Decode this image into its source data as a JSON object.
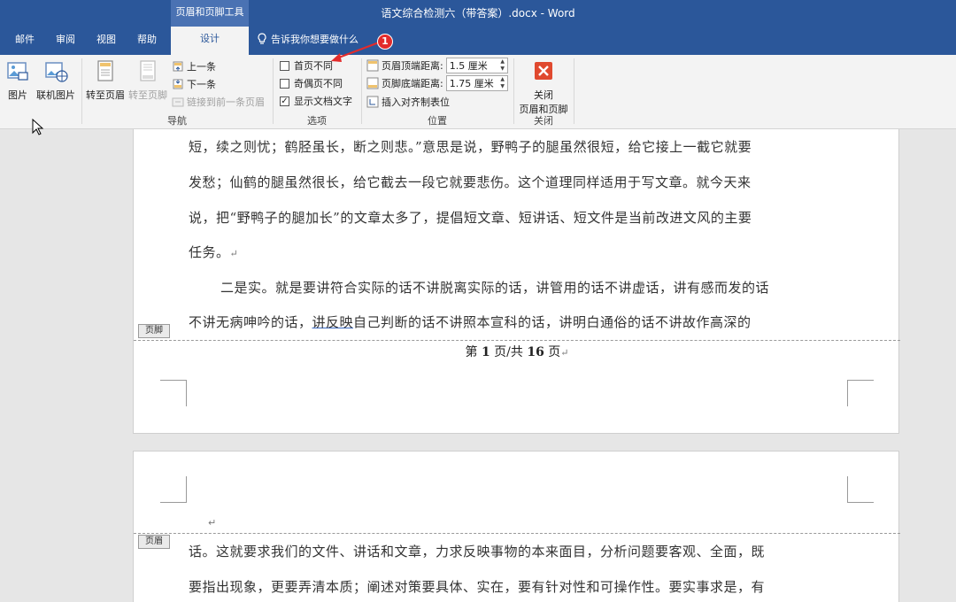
{
  "window": {
    "title": "语文综合检测六（带答案）.docx  -  Word",
    "context_group": "页眉和页脚工具",
    "tabs": [
      "邮件",
      "审阅",
      "视图",
      "帮助"
    ],
    "active_tab": "设计",
    "tell_me": "告诉我你想要做什么"
  },
  "ribbon": {
    "insert": {
      "picture": "图片",
      "online_picture": "联机图片"
    },
    "navigation": {
      "goto_header": "转至页眉",
      "goto_footer": "转至页脚",
      "previous": "上一条",
      "next": "下一条",
      "link_previous": "链接到前一条页眉",
      "group_label": "导航"
    },
    "options": {
      "diff_first": {
        "label": "首页不同",
        "checked": false
      },
      "diff_odd_even": {
        "label": "奇偶页不同",
        "checked": false
      },
      "show_doc_text": {
        "label": "显示文档文字",
        "checked": true
      },
      "group_label": "选项"
    },
    "position": {
      "header_from_top_label": "页眉顶端距离:",
      "header_from_top_value": "1.5 厘米",
      "footer_from_bottom_label": "页脚底端距离:",
      "footer_from_bottom_value": "1.75 厘米",
      "insert_align_tab": "插入对齐制表位",
      "group_label": "位置"
    },
    "close": {
      "label_line1": "关闭",
      "label_line2": "页眉和页脚",
      "group_label": "关闭"
    }
  },
  "annotation": {
    "marker": "1",
    "color": "#e32b2b"
  },
  "page1": {
    "lines": [
      "短，续之则忧；鹤胫虽长，断之则悲。”意思是说，野鸭子的腿虽然很短，给它接上一截它就要",
      "发愁；仙鹤的腿虽然很长，给它截去一段它就要悲伤。这个道理同样适用于写文章。就今天来",
      "说，把“野鸭子的腿加长”的文章太多了，提倡短文章、短讲话、短文件是当前改进文风的主要",
      "任务。",
      "二是实。就是要讲符合实际的话不讲脱离实际的话，讲管用的话不讲虚话，讲有感而发的话",
      "不讲无病呻吟的话，",
      "讲反映",
      "自己判断的话不讲照本宣科的话，讲明白通俗的话不讲故作高深的"
    ],
    "footer_tag": "页脚",
    "footer": {
      "prefix": "第",
      "current": "1",
      "mid": "页/共",
      "total": "16",
      "suffix": "页"
    }
  },
  "page2": {
    "header_tag": "页眉",
    "lines": [
      "话。这就要求我们的文件、讲话和文章，力求反映事物的本来面目，分析问题要客观、全面，既",
      "要指出现象，更要弄清本质；阐述对策要具体、实在，要有针对性和可操作性。要实事求是，有"
    ]
  },
  "colors": {
    "accent": "#2b579a",
    "ribbon_bg": "#f3f3f3",
    "close_red": "#e0492f"
  }
}
